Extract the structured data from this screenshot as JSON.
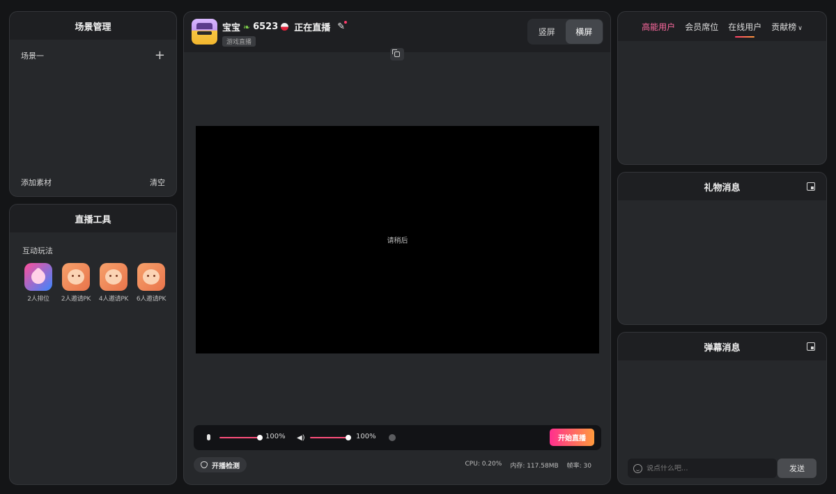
{
  "scene_panel": {
    "title": "场景管理",
    "scene_name": "场景一",
    "add_material_label": "添加素材",
    "clear_label": "清空"
  },
  "tools_panel": {
    "title": "直播工具",
    "section_title": "互动玩法",
    "tools": [
      {
        "label": "2人排位",
        "icon": "heart-icon"
      },
      {
        "label": "2人邀请PK",
        "icon": "pk-face-icon"
      },
      {
        "label": "4人邀请PK",
        "icon": "pk-face-icon"
      },
      {
        "label": "6人邀请PK",
        "icon": "pk-face-icon"
      }
    ]
  },
  "main": {
    "user_name": "宝宝",
    "fans_count": "6523",
    "live_status": "正在直播",
    "category_tag": "游戏直播",
    "orientation": {
      "portrait_label": "竖屏",
      "landscape_label": "横屏",
      "selected": "横屏"
    },
    "preview_text": "请稍后",
    "mic_volume": "100%",
    "speaker_volume": "100%",
    "mic_level": 1.0,
    "speaker_level": 1.0,
    "start_button_label": "开始直播",
    "check_button_label": "开播检测",
    "stats": {
      "cpu": "CPU: 0.20%",
      "memory": "内存: 117.58MB",
      "fps": "帧率: 30"
    },
    "accent_gradient": [
      "#ff2f8f",
      "#ff9a3c"
    ]
  },
  "users_panel": {
    "tabs": [
      {
        "label": "高能用户",
        "state": "hot"
      },
      {
        "label": "会员席位",
        "state": "normal"
      },
      {
        "label": "在线用户",
        "state": "active"
      },
      {
        "label": "贡献榜",
        "state": "dropdown"
      }
    ]
  },
  "gift_panel": {
    "title": "礼物消息"
  },
  "danmu_panel": {
    "title": "弹幕消息",
    "input_placeholder": "说点什么吧...",
    "send_label": "发送"
  }
}
